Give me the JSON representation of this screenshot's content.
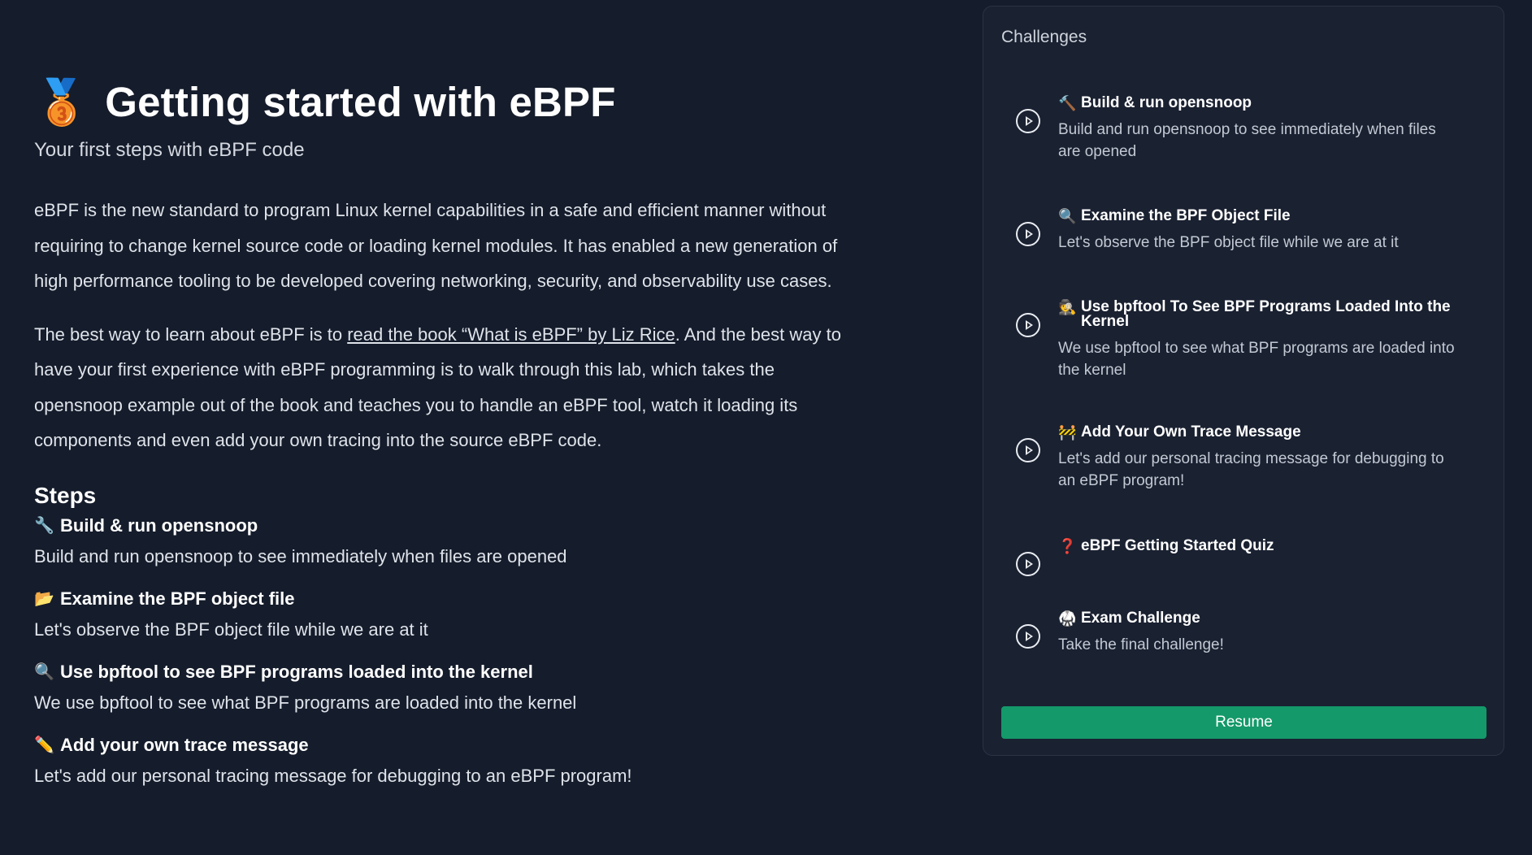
{
  "header": {
    "medal_emoji": "🥉",
    "title": "Getting started with eBPF",
    "subtitle": "Your first steps with eBPF code"
  },
  "intro": {
    "para1": "eBPF is the new standard to program Linux kernel capabilities in a safe and efficient manner without requiring to change kernel source code or loading kernel modules. It has enabled a new generation of high performance tooling to be developed covering networking, security, and observability use cases.",
    "para2_before": "The best way to learn about eBPF is to ",
    "para2_link": "read the book “What is eBPF” by Liz Rice",
    "para2_after": ". And the best way to have your first experience with eBPF programming is to walk through this lab, which takes the opensnoop example out of the book and teaches you to handle an eBPF tool, watch it loading its components and even add your own tracing into the source eBPF code."
  },
  "steps": {
    "heading": "Steps",
    "items": [
      {
        "emoji": "🔧",
        "title": "Build & run opensnoop",
        "desc": "Build and run opensnoop to see immediately when files are opened"
      },
      {
        "emoji": "📂",
        "title": "Examine the BPF object file",
        "desc": "Let's observe the BPF object file while we are at it"
      },
      {
        "emoji": "🔍",
        "title": "Use bpftool to see BPF programs loaded into the kernel",
        "desc": "We use bpftool to see what BPF programs are loaded into the kernel"
      },
      {
        "emoji": "✏️",
        "title": "Add your own trace message",
        "desc": "Let's add our personal tracing message for debugging to an eBPF program!"
      }
    ]
  },
  "panel": {
    "title": "Challenges",
    "challenges": [
      {
        "emoji": "🔨",
        "title": "Build & run opensnoop",
        "desc": "Build and run opensnoop to see immediately when files are opened"
      },
      {
        "emoji": "🔍",
        "title": "Examine the BPF Object File",
        "desc": "Let's observe the BPF object file while we are at it"
      },
      {
        "emoji": "🕵",
        "title": "Use bpftool To See BPF Programs Loaded Into the Kernel",
        "desc": "We use bpftool to see what BPF programs are loaded into the kernel"
      },
      {
        "emoji": "🚧",
        "title": "Add Your Own Trace Message",
        "desc": "Let's add our personal tracing message for debugging to an eBPF program!"
      },
      {
        "emoji": "❓",
        "title": "eBPF Getting Started Quiz",
        "desc": ""
      },
      {
        "emoji": "🥋",
        "title": "Exam Challenge",
        "desc": "Take the final challenge!"
      }
    ],
    "resume_label": "Resume"
  },
  "colors": {
    "background": "#151c2b",
    "panel": "#1a2131",
    "accent": "#14996a"
  }
}
